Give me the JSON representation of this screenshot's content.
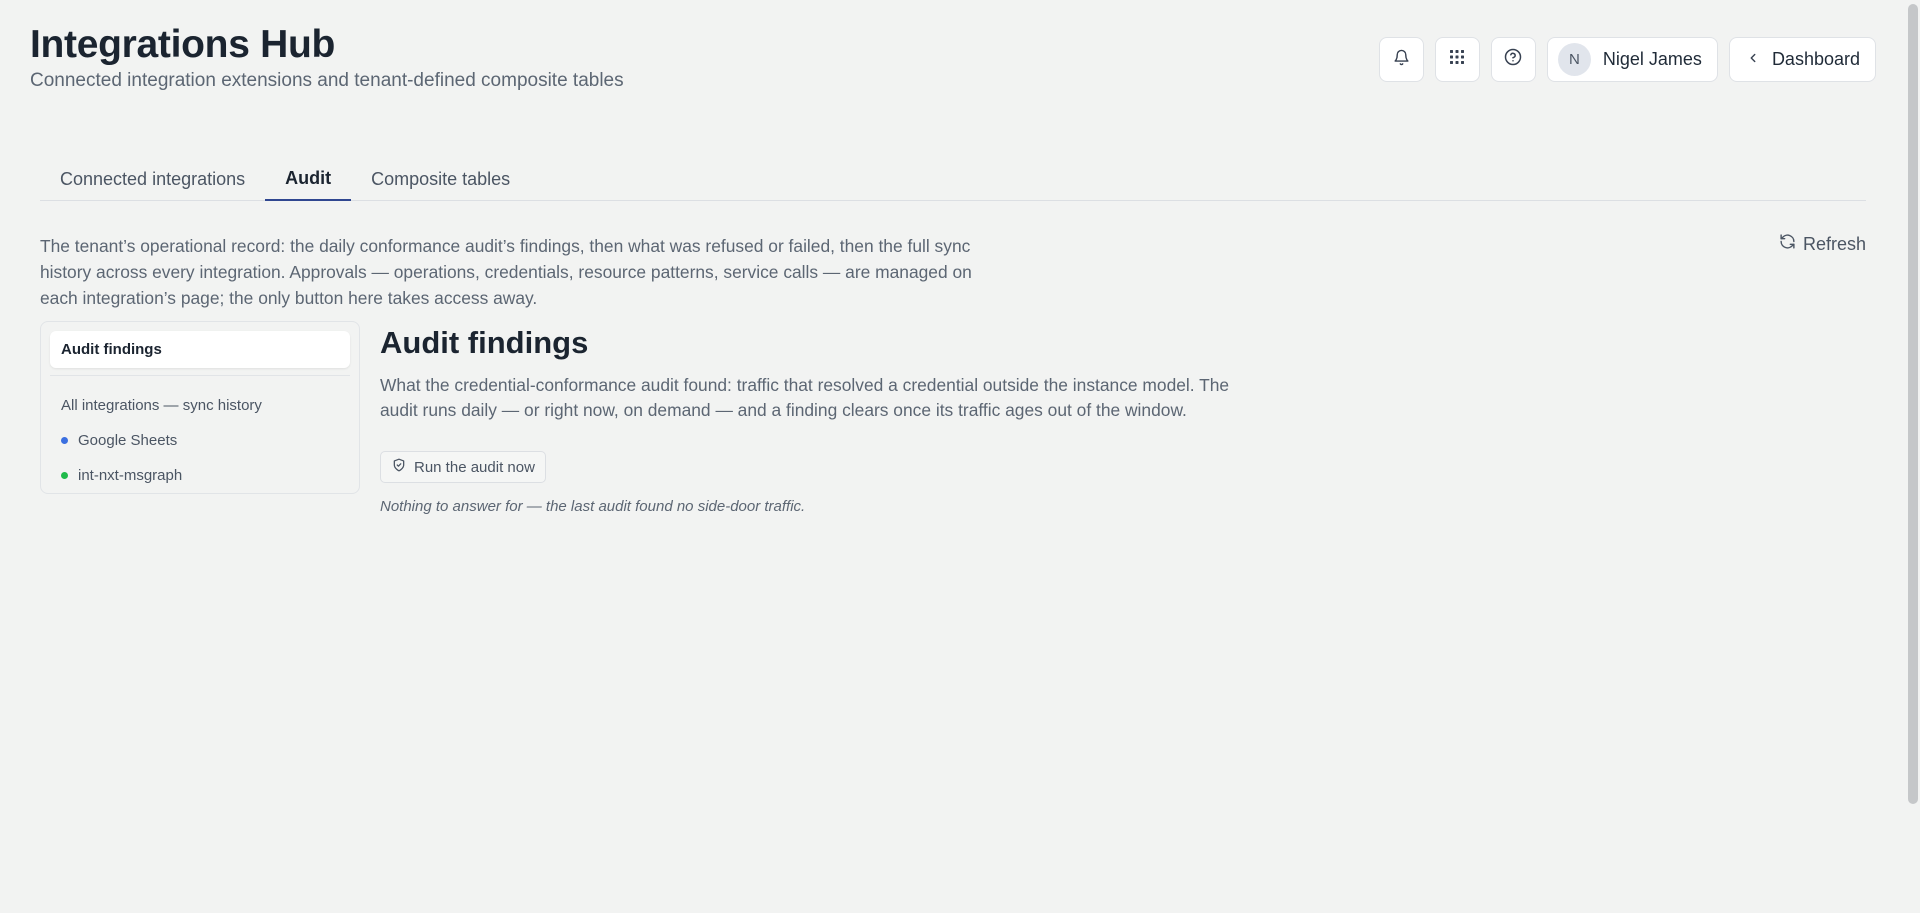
{
  "header": {
    "title": "Integrations Hub",
    "subtitle": "Connected integration extensions and tenant-defined composite tables",
    "icons": [
      "bell-icon",
      "apps-grid-icon",
      "help-icon"
    ],
    "user": {
      "initial": "N",
      "name": "Nigel James"
    },
    "back_label": "Dashboard"
  },
  "tabs": [
    {
      "label": "Connected integrations",
      "active": false
    },
    {
      "label": "Audit",
      "active": true
    },
    {
      "label": "Composite tables",
      "active": false
    }
  ],
  "audit": {
    "intro": "The tenant’s operational record: the daily conformance audit’s findings, then what was refused or failed, then the full sync history across every integration. Approvals — operations, credentials, resource patterns, service calls — are managed on each integration’s page; the only button here takes access away.",
    "refresh_label": "Refresh",
    "side": {
      "active": "Audit findings",
      "all_label": "All integrations — sync history",
      "integrations": [
        {
          "name": "Google Sheets",
          "color": "#3b6fe0"
        },
        {
          "name": "int-nxt-msgraph",
          "color": "#1fba4a"
        }
      ]
    },
    "main": {
      "title": "Audit findings",
      "description": "What the credential-conformance audit found: traffic that resolved a credential outside the instance model. The audit runs daily — or right now, on demand — and a finding clears once its traffic ages out of the window.",
      "run_label": "Run the audit now",
      "empty_note": "Nothing to answer for — the last audit found no side-door traffic."
    }
  }
}
